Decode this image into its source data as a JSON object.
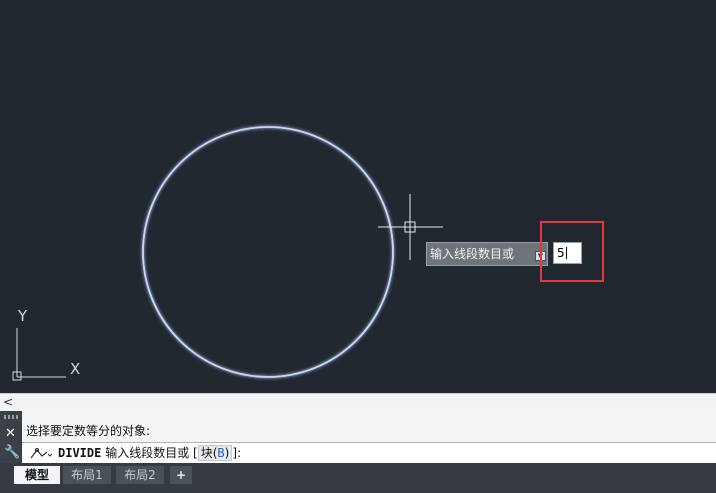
{
  "app": {
    "colors": {
      "canvas": "#212830",
      "circle": "#c7d9ff",
      "highlight": "#e43a3a",
      "command_key": "#1b5fc7"
    }
  },
  "canvas": {
    "ucs": {
      "y_label": "Y",
      "x_label": "X"
    },
    "tooltip": {
      "prompt": "输入线段数目或",
      "arrow_icon": "dropdown-arrow-icon"
    },
    "input": {
      "value": "5"
    }
  },
  "scroll": {
    "left_arrow": "<"
  },
  "command": {
    "history": "选择要定数等分的对象:",
    "name": "DIVIDE",
    "prompt": "输入线段数目或",
    "bracket_open": "[",
    "option_label": "块(",
    "option_key": "B",
    "option_close": ")",
    "bracket_close": "]:"
  },
  "tabs": [
    {
      "label": "模型"
    },
    {
      "label": "布局1"
    },
    {
      "label": "布局2"
    },
    {
      "label": "+"
    }
  ]
}
